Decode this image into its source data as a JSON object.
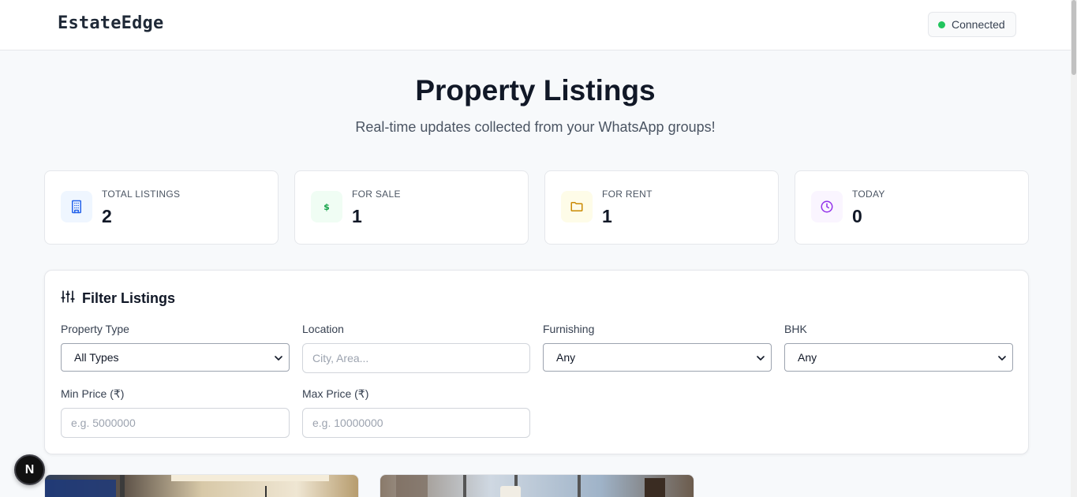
{
  "header": {
    "brand": "EstateEdge",
    "status": "Connected",
    "status_color": "#22c55e"
  },
  "hero": {
    "title": "Property Listings",
    "subtitle": "Real-time updates collected from your WhatsApp groups!"
  },
  "stats": [
    {
      "label": "TOTAL LISTINGS",
      "value": "2",
      "icon": "building-icon",
      "color": "#2563eb",
      "bg": "#eff6ff"
    },
    {
      "label": "FOR SALE",
      "value": "1",
      "icon": "dollar-icon",
      "color": "#16a34a",
      "bg": "#f0fdf4"
    },
    {
      "label": "FOR RENT",
      "value": "1",
      "icon": "folder-icon",
      "color": "#ca8a04",
      "bg": "#fefce8"
    },
    {
      "label": "TODAY",
      "value": "0",
      "icon": "clock-icon",
      "color": "#9333ea",
      "bg": "#faf5ff"
    }
  ],
  "filters": {
    "title": "Filter Listings",
    "property_type": {
      "label": "Property Type",
      "value": "All Types"
    },
    "location": {
      "label": "Location",
      "placeholder": "City, Area..."
    },
    "furnishing": {
      "label": "Furnishing",
      "value": "Any"
    },
    "bhk": {
      "label": "BHK",
      "value": "Any"
    },
    "min_price": {
      "label": "Min Price (₹)",
      "placeholder": "e.g. 5000000"
    },
    "max_price": {
      "label": "Max Price (₹)",
      "placeholder": "e.g. 10000000"
    }
  },
  "dev_badge": "N"
}
